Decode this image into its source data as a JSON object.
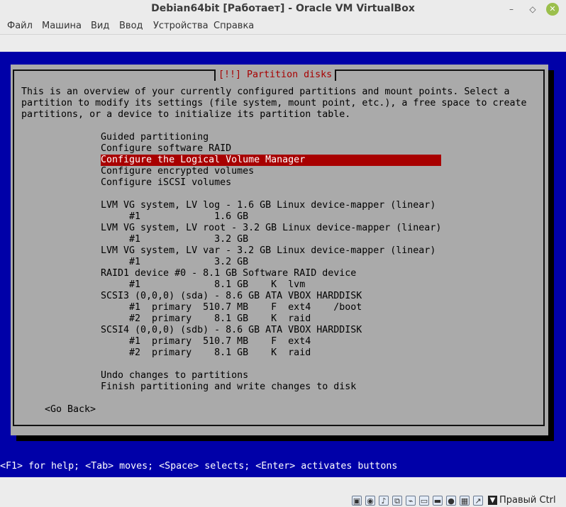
{
  "window": {
    "title": "Debian64bit [Работает] - Oracle VM VirtualBox",
    "minimize_glyph": "–",
    "maximize_glyph": "◇",
    "close_glyph": "✕"
  },
  "menu": [
    "Файл",
    "Машина",
    "Вид",
    "Ввод",
    "Устройства",
    "Справка"
  ],
  "installer": {
    "dialog_title": "[!!] Partition disks",
    "intro": [
      "This is an overview of your currently configured partitions and mount points. Select a",
      "partition to modify its settings (file system, mount point, etc.), a free space to create",
      "partitions, or a device to initialize its partition table."
    ],
    "items": [
      "Guided partitioning",
      "Configure software RAID",
      "Configure the Logical Volume Manager",
      "Configure encrypted volumes",
      "Configure iSCSI volumes",
      "",
      "LVM VG system, LV log - 1.6 GB Linux device-mapper (linear)",
      "     #1             1.6 GB",
      "LVM VG system, LV root - 3.2 GB Linux device-mapper (linear)",
      "     #1             3.2 GB",
      "LVM VG system, LV var - 3.2 GB Linux device-mapper (linear)",
      "     #1             3.2 GB",
      "RAID1 device #0 - 8.1 GB Software RAID device",
      "     #1             8.1 GB    K  lvm",
      "SCSI3 (0,0,0) (sda) - 8.6 GB ATA VBOX HARDDISK",
      "     #1  primary  510.7 MB    F  ext4    /boot",
      "     #2  primary    8.1 GB    K  raid",
      "SCSI4 (0,0,0) (sdb) - 8.6 GB ATA VBOX HARDDISK",
      "     #1  primary  510.7 MB    F  ext4",
      "     #2  primary    8.1 GB    K  raid",
      "",
      "Undo changes to partitions",
      "Finish partitioning and write changes to disk"
    ],
    "selected_index": 2,
    "go_back": "<Go Back>",
    "help": "<F1> for help; <Tab> moves; <Space> selects; <Enter> activates buttons"
  },
  "statusbar": {
    "icons": [
      "hard-disk-icon",
      "optical-drive-icon",
      "audio-icon",
      "network-icon",
      "usb-icon",
      "shared-folders-icon",
      "display-icon",
      "video-capture-icon",
      "cpu-icon",
      "mouse-integration-icon"
    ],
    "host_key": "Правый Ctrl"
  },
  "colors": {
    "vm_background": "#0000a8",
    "dialog": "#aaaaaa",
    "selection": "#a80000",
    "dialog_title": "#a80000"
  }
}
